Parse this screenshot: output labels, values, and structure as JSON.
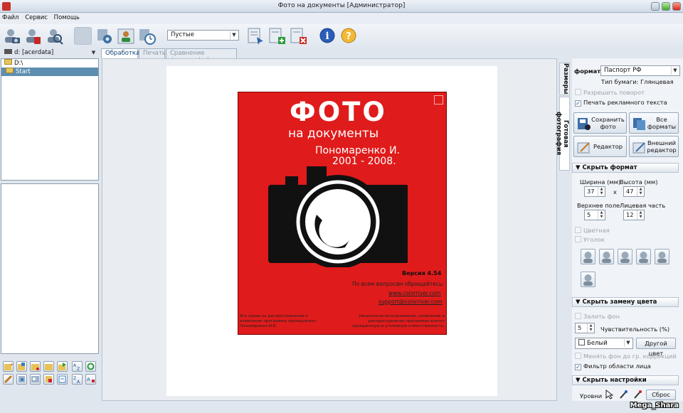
{
  "window": {
    "title": "Фото на документы  [Администратор]"
  },
  "menu": [
    "Файл",
    "Сервис",
    "Помощь"
  ],
  "toolbar": {
    "filter_combo": "Пустые",
    "info_icon": "info-icon",
    "help_icon": "help-icon"
  },
  "left": {
    "drive_combo": "d: [acerdata]",
    "tree": [
      "D:\\",
      "Start"
    ]
  },
  "tabs": [
    "Обработка",
    "Печать",
    "Сравнение фотографий"
  ],
  "splash": {
    "title": "ФОТО",
    "subtitle": "на документы",
    "author": "Пономаренко И.",
    "years": "2001 - 2008.",
    "version": "Версия 4.54",
    "contact_prompt": "По всем вопросам обращайтесь:",
    "website": "www.colorriver.com",
    "email": "support@colorriver.com",
    "rights": "Все права на распространение и изменение программы принадлежат Пономаренко И.В.",
    "warning": "Незаконное использование, изменение и распространение программы влечет гражданскую и уголовную ответственность."
  },
  "side_tabs": [
    "Размеры",
    "Готовая фотография"
  ],
  "right": {
    "format_label": "формат",
    "format_value": "Паспорт РФ",
    "paper_type": "Тип бумаги:  Глянцевая",
    "allow_rotate": "Разрешить поворот",
    "print_ad_text": "Печать рекламного текста",
    "save_photo": "Сохранить фото",
    "all_formats": "Все форматы",
    "editor": "Редактор",
    "external_editor": "Внешний редактор",
    "section_format": "Скрыть формат",
    "width_label": "Ширина (мм)",
    "height_label": "Высота (мм)",
    "width_value": "37",
    "times": "x",
    "height_value": "47",
    "top_margin_label": "Верхнее поле",
    "face_part_label": "Лицевая часть",
    "top_margin_value": "5",
    "face_part_value": "12",
    "color_option": "Цветная",
    "corner_option": "Уголок",
    "section_color": "Скрыть замену цвета",
    "fill_background": "Залить фон",
    "sensitivity_value": "5",
    "sensitivity_label": "Чувствительность (%)",
    "color_combo": "Белый",
    "other_color": "Другой цвет",
    "change_bg": "Менять фон до гр. коррекций",
    "face_filter": "Фильтр области лица",
    "section_settings": "Скрыть настройки",
    "levels": "Уровни",
    "reset": "Сброс"
  },
  "watermark": "Mega_Shara"
}
